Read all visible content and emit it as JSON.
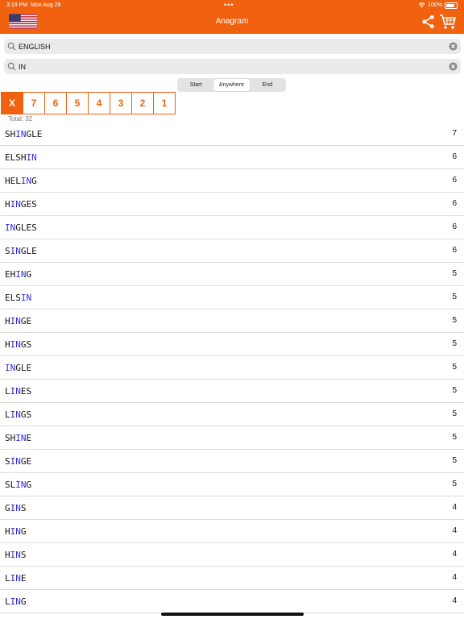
{
  "status": {
    "time": "3:19 PM",
    "date": "Mon Aug 29",
    "battery": "100%"
  },
  "header": {
    "title": "Anagram",
    "accent": "#f0620f"
  },
  "search": {
    "letters": "ENGLISH",
    "pattern": "IN"
  },
  "position_segment": {
    "options": [
      "Start",
      "Anywhere",
      "End"
    ],
    "selected": "Anywhere"
  },
  "length_filters": [
    "X",
    "7",
    "6",
    "5",
    "4",
    "3",
    "2",
    "1"
  ],
  "total": "Total:  32",
  "words": [
    {
      "pre": "SH",
      "hl": "IN",
      "post": "GLE",
      "count": "7"
    },
    {
      "pre": "ELSH",
      "hl": "IN",
      "post": "",
      "count": "6"
    },
    {
      "pre": "HEL",
      "hl": "IN",
      "post": "G",
      "count": "6"
    },
    {
      "pre": "H",
      "hl": "IN",
      "post": "GES",
      "count": "6"
    },
    {
      "pre": "",
      "hl": "IN",
      "post": "GLES",
      "count": "6"
    },
    {
      "pre": "S",
      "hl": "IN",
      "post": "GLE",
      "count": "6"
    },
    {
      "pre": "EH",
      "hl": "IN",
      "post": "G",
      "count": "5"
    },
    {
      "pre": "ELS",
      "hl": "IN",
      "post": "",
      "count": "5"
    },
    {
      "pre": "H",
      "hl": "IN",
      "post": "GE",
      "count": "5"
    },
    {
      "pre": "H",
      "hl": "IN",
      "post": "GS",
      "count": "5"
    },
    {
      "pre": "",
      "hl": "IN",
      "post": "GLE",
      "count": "5"
    },
    {
      "pre": "L",
      "hl": "IN",
      "post": "ES",
      "count": "5"
    },
    {
      "pre": "L",
      "hl": "IN",
      "post": "GS",
      "count": "5"
    },
    {
      "pre": "SH",
      "hl": "IN",
      "post": "E",
      "count": "5"
    },
    {
      "pre": "S",
      "hl": "IN",
      "post": "GE",
      "count": "5"
    },
    {
      "pre": "SL",
      "hl": "IN",
      "post": "G",
      "count": "5"
    },
    {
      "pre": "G",
      "hl": "IN",
      "post": "S",
      "count": "4"
    },
    {
      "pre": "H",
      "hl": "IN",
      "post": "G",
      "count": "4"
    },
    {
      "pre": "H",
      "hl": "IN",
      "post": "S",
      "count": "4"
    },
    {
      "pre": "L",
      "hl": "IN",
      "post": "E",
      "count": "4"
    },
    {
      "pre": "L",
      "hl": "IN",
      "post": "G",
      "count": "4"
    }
  ]
}
